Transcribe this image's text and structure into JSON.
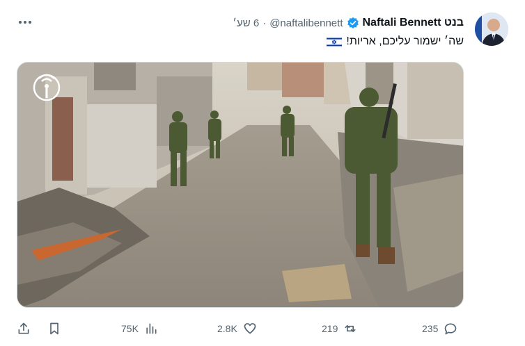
{
  "author": {
    "display_name": "Naftali Bennett בנט",
    "handle": "@naftalibennett",
    "separator": "·",
    "time": "6 שע׳"
  },
  "tweet": {
    "text": "שה׳ ישמור עליכם, אריות!"
  },
  "metrics": {
    "replies": "235",
    "retweets": "219",
    "likes": "2.8K",
    "views": "75K"
  },
  "icons": {
    "more": "more-horizontal-icon",
    "verified": "verified-badge-icon",
    "flag": "israel-flag-icon",
    "media_watermark": "broadcast-antenna-icon",
    "reply": "reply-icon",
    "retweet": "retweet-icon",
    "like": "like-icon",
    "views": "views-icon",
    "bookmark": "bookmark-icon",
    "share": "share-icon"
  },
  "colors": {
    "text_primary": "#0f1419",
    "text_secondary": "#536471",
    "verified": "#1d9bf0",
    "flag_blue": "#0038b8"
  }
}
